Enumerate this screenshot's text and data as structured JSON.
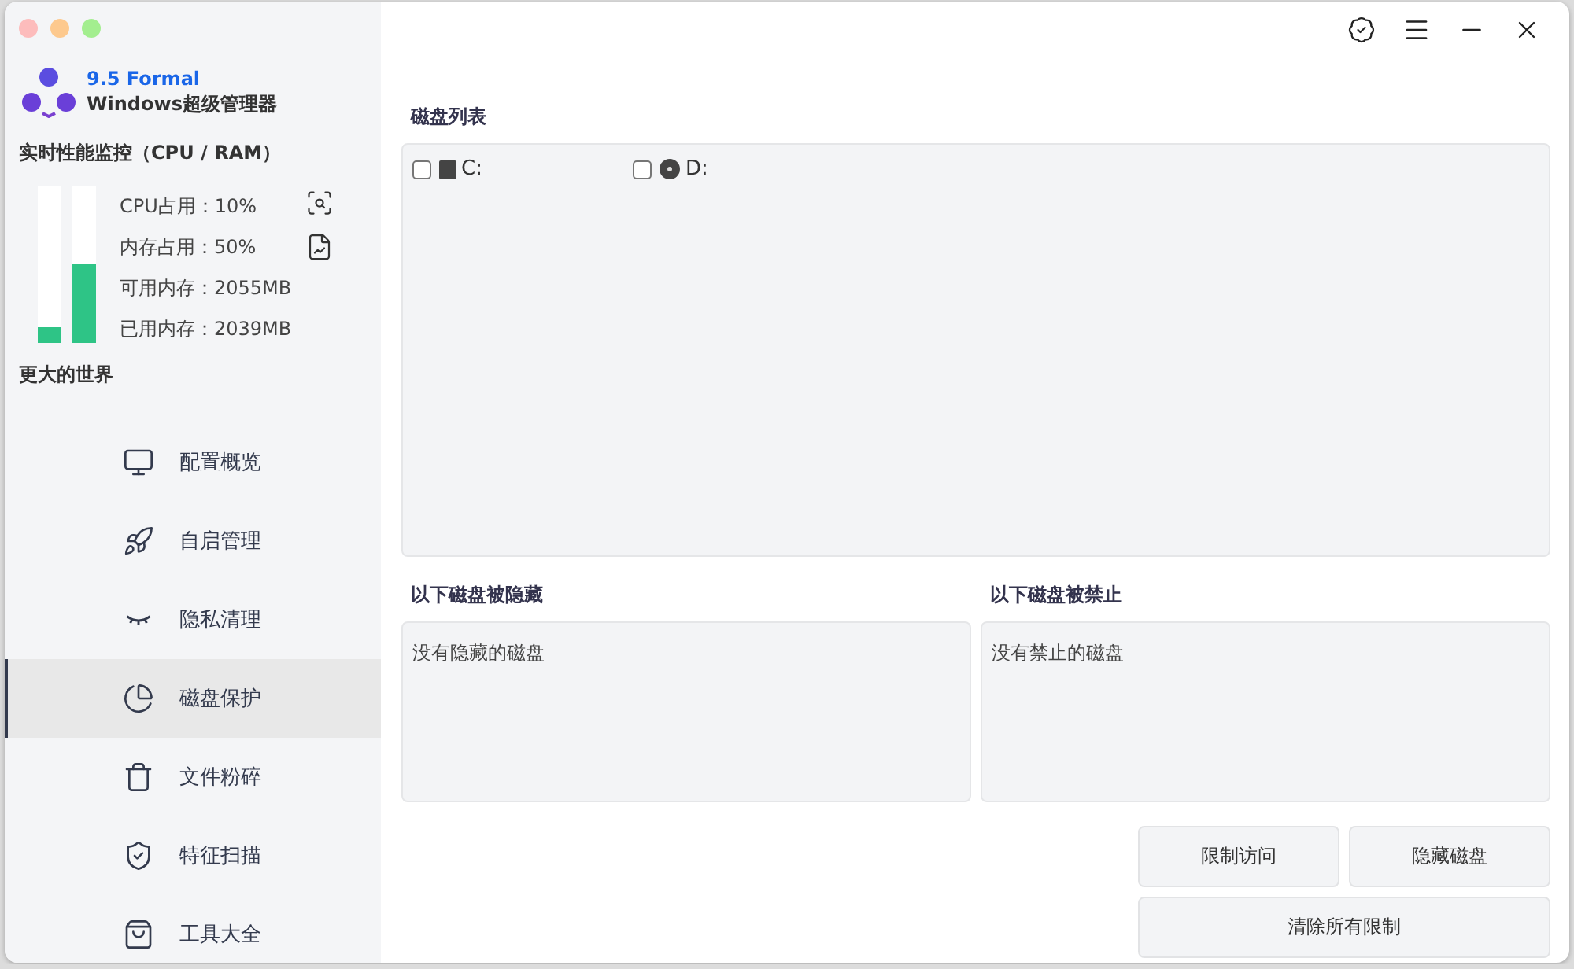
{
  "app": {
    "version": "9.5 Formal",
    "name": "Windows超级管理器"
  },
  "monitor": {
    "title": "实时性能监控（CPU / RAM）",
    "bars": [
      {
        "level": 0.1
      },
      {
        "level": 0.5
      }
    ],
    "stats": [
      "CPU占用：10%",
      "内存占用：50%",
      "可用内存：2055MB",
      "已用内存：2039MB"
    ]
  },
  "section_title": "更大的世界",
  "sidebar": {
    "items": [
      {
        "label": "配置概览",
        "selected": false
      },
      {
        "label": "自启管理",
        "selected": false
      },
      {
        "label": "隐私清理",
        "selected": false
      },
      {
        "label": "磁盘保护",
        "selected": true
      },
      {
        "label": "文件粉碎",
        "selected": false
      },
      {
        "label": "特征扫描",
        "selected": false
      },
      {
        "label": "工具大全",
        "selected": false
      }
    ]
  },
  "disk_list": {
    "title": "磁盘列表",
    "disks": [
      {
        "label": "C:",
        "kind": "hdd",
        "checked": false
      },
      {
        "label": "D:",
        "kind": "optical",
        "checked": false
      }
    ]
  },
  "hidden": {
    "title": "以下磁盘被隐藏",
    "text": "没有隐藏的磁盘"
  },
  "blocked": {
    "title": "以下磁盘被禁止",
    "text": "没有禁止的磁盘"
  },
  "buttons": [
    "限制访问",
    "隐藏磁盘",
    "清除所有限制"
  ]
}
